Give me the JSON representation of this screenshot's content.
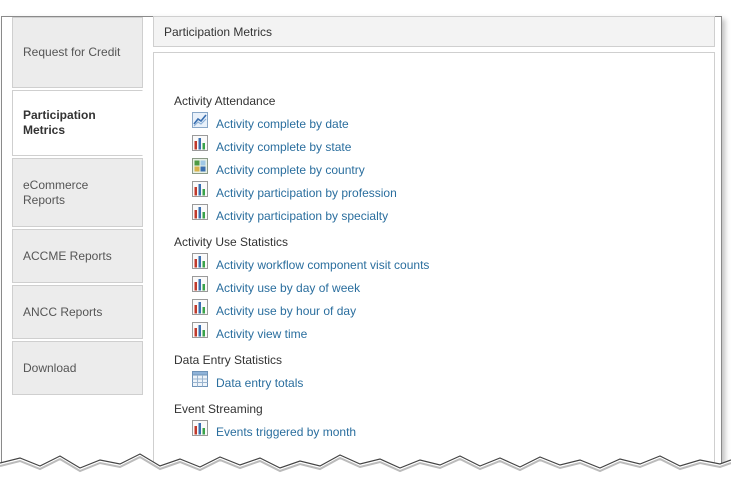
{
  "sidebar": {
    "items": [
      {
        "label": "Request for Credit",
        "active": false
      },
      {
        "label": "Participation Metrics",
        "active": true
      },
      {
        "label": "eCommerce Reports",
        "active": false
      },
      {
        "label": "ACCME Reports",
        "active": false
      },
      {
        "label": "ANCC Reports",
        "active": false
      },
      {
        "label": "Download",
        "active": false
      }
    ]
  },
  "header": {
    "title": "Participation Metrics"
  },
  "sections": [
    {
      "title": "Activity Attendance",
      "links": [
        {
          "label": "Activity complete by date",
          "icon": "line-chart-icon"
        },
        {
          "label": "Activity complete by state",
          "icon": "bar-chart-icon"
        },
        {
          "label": "Activity complete by country",
          "icon": "map-chart-icon"
        },
        {
          "label": "Activity participation by profession",
          "icon": "bar-chart-icon"
        },
        {
          "label": "Activity participation by specialty",
          "icon": "bar-chart-icon"
        }
      ]
    },
    {
      "title": "Activity Use Statistics",
      "links": [
        {
          "label": "Activity workflow component visit counts",
          "icon": "bar-chart-icon"
        },
        {
          "label": "Activity use by day of week",
          "icon": "bar-chart-icon"
        },
        {
          "label": "Activity use by hour of day",
          "icon": "bar-chart-icon"
        },
        {
          "label": "Activity view time",
          "icon": "bar-chart-icon"
        }
      ]
    },
    {
      "title": "Data Entry Statistics",
      "links": [
        {
          "label": "Data entry totals",
          "icon": "table-icon"
        }
      ]
    },
    {
      "title": "Event Streaming",
      "links": [
        {
          "label": "Events triggered by month",
          "icon": "bar-chart-icon"
        }
      ]
    }
  ],
  "colors": {
    "link": "#2a6e9e",
    "tab_background": "#ececec",
    "border": "#cfcfcf"
  }
}
